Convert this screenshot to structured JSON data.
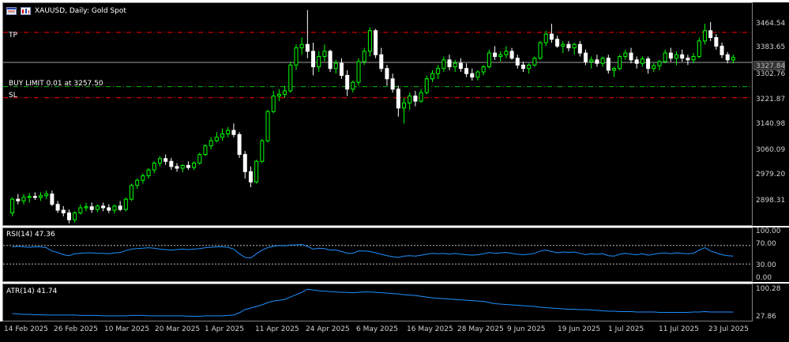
{
  "header": {
    "symbol_text": "XAUUSD, Daily:  Gold Spot",
    "icons": [
      "window-menu-icon",
      "chart-type-icon"
    ]
  },
  "levels": {
    "tp_label": "TP",
    "buy_limit_label": "BUY LIMIT 0.01 at 3257.50",
    "sl_label": "SL",
    "current_price": "3327.84"
  },
  "price_scale": [
    "3464.54",
    "3383.65",
    "3302.76",
    "3221.87",
    "3140.98",
    "3060.09",
    "2979.20",
    "2898.31"
  ],
  "rsi": {
    "label": "RSI(14) 47.36",
    "scale": [
      "100.00",
      "70.00",
      "30.00",
      "0.00"
    ]
  },
  "atr": {
    "label": "ATR(14) 41.74",
    "scale": [
      "100.28",
      "27.86"
    ]
  },
  "time_axis": [
    "14 Feb 2025",
    "26 Feb 2025",
    "10 Mar 2025",
    "20 Mar 2025",
    "1 Apr 2025",
    "11 Apr 2025",
    "24 Apr 2025",
    "6 May 2025",
    "16 May 2025",
    "28 May 2025",
    "9 Jun 2025",
    "19 Jun 2025",
    "1 Jul 2025",
    "11 Jul 2025",
    "23 Jul 2025"
  ],
  "colors": {
    "background": "#000000",
    "bull_candle": "#00ff00",
    "bear_candle": "#ffffff",
    "tp_sl_line": "#ff0000",
    "buy_limit_line": "#00c000",
    "indicator_line": "#1e90ff",
    "price_line": "#a0a0a0"
  },
  "chart_data": {
    "type": "candlestick",
    "title": "XAUUSD, Daily:  Gold Spot",
    "ylim": [
      2850,
      3500
    ],
    "levels": {
      "tp": 3415,
      "buy_limit": 3257.5,
      "sl": 3225,
      "current": 3327.84
    },
    "candles": [
      [
        2890,
        2935,
        2880,
        2930
      ],
      [
        2930,
        2945,
        2915,
        2925
      ],
      [
        2925,
        2945,
        2915,
        2935
      ],
      [
        2935,
        2948,
        2920,
        2938
      ],
      [
        2938,
        2950,
        2928,
        2935
      ],
      [
        2935,
        2950,
        2925,
        2940
      ],
      [
        2940,
        2955,
        2930,
        2945
      ],
      [
        2945,
        2955,
        2910,
        2915
      ],
      [
        2915,
        2925,
        2890,
        2898
      ],
      [
        2898,
        2910,
        2880,
        2890
      ],
      [
        2890,
        2900,
        2860,
        2870
      ],
      [
        2870,
        2895,
        2862,
        2890
      ],
      [
        2890,
        2915,
        2885,
        2905
      ],
      [
        2905,
        2920,
        2895,
        2908
      ],
      [
        2908,
        2920,
        2890,
        2900
      ],
      [
        2900,
        2915,
        2892,
        2910
      ],
      [
        2910,
        2920,
        2895,
        2905
      ],
      [
        2905,
        2915,
        2890,
        2898
      ],
      [
        2898,
        2915,
        2888,
        2910
      ],
      [
        2910,
        2925,
        2895,
        2900
      ],
      [
        2900,
        2935,
        2895,
        2930
      ],
      [
        2930,
        2975,
        2925,
        2970
      ],
      [
        2970,
        2990,
        2960,
        2985
      ],
      [
        2985,
        3005,
        2975,
        2998
      ],
      [
        2998,
        3020,
        2990,
        3015
      ],
      [
        3015,
        3040,
        3005,
        3035
      ],
      [
        3035,
        3055,
        3025,
        3048
      ],
      [
        3048,
        3060,
        3030,
        3040
      ],
      [
        3040,
        3050,
        3015,
        3025
      ],
      [
        3025,
        3035,
        3010,
        3020
      ],
      [
        3020,
        3032,
        3008,
        3028
      ],
      [
        3028,
        3040,
        3015,
        3022
      ],
      [
        3022,
        3040,
        3015,
        3035
      ],
      [
        3035,
        3065,
        3030,
        3060
      ],
      [
        3060,
        3090,
        3055,
        3085
      ],
      [
        3085,
        3110,
        3075,
        3100
      ],
      [
        3100,
        3125,
        3095,
        3110
      ],
      [
        3110,
        3135,
        3100,
        3120
      ],
      [
        3120,
        3140,
        3110,
        3130
      ],
      [
        3130,
        3150,
        3110,
        3118
      ],
      [
        3118,
        3125,
        3050,
        3060
      ],
      [
        3060,
        3070,
        2990,
        3010
      ],
      [
        3010,
        3025,
        2965,
        2980
      ],
      [
        2980,
        3045,
        2975,
        3040
      ],
      [
        3040,
        3105,
        3035,
        3100
      ],
      [
        3100,
        3190,
        3095,
        3185
      ],
      [
        3185,
        3245,
        3180,
        3230
      ],
      [
        3230,
        3250,
        3215,
        3235
      ],
      [
        3235,
        3260,
        3225,
        3245
      ],
      [
        3245,
        3330,
        3240,
        3320
      ],
      [
        3320,
        3380,
        3305,
        3370
      ],
      [
        3370,
        3400,
        3350,
        3380
      ],
      [
        3380,
        3480,
        3340,
        3360
      ],
      [
        3360,
        3385,
        3290,
        3315
      ],
      [
        3315,
        3360,
        3300,
        3345
      ],
      [
        3345,
        3380,
        3330,
        3360
      ],
      [
        3360,
        3365,
        3300,
        3310
      ],
      [
        3310,
        3335,
        3295,
        3325
      ],
      [
        3325,
        3340,
        3280,
        3290
      ],
      [
        3290,
        3305,
        3230,
        3250
      ],
      [
        3250,
        3275,
        3240,
        3270
      ],
      [
        3270,
        3340,
        3260,
        3330
      ],
      [
        3330,
        3370,
        3320,
        3360
      ],
      [
        3360,
        3430,
        3345,
        3420
      ],
      [
        3420,
        3425,
        3340,
        3350
      ],
      [
        3350,
        3370,
        3300,
        3310
      ],
      [
        3310,
        3320,
        3260,
        3280
      ],
      [
        3280,
        3295,
        3240,
        3250
      ],
      [
        3250,
        3260,
        3170,
        3195
      ],
      [
        3195,
        3225,
        3150,
        3210
      ],
      [
        3210,
        3240,
        3190,
        3230
      ],
      [
        3230,
        3245,
        3200,
        3215
      ],
      [
        3215,
        3250,
        3210,
        3240
      ],
      [
        3240,
        3290,
        3235,
        3280
      ],
      [
        3280,
        3305,
        3270,
        3295
      ],
      [
        3295,
        3320,
        3280,
        3310
      ],
      [
        3310,
        3345,
        3300,
        3335
      ],
      [
        3335,
        3350,
        3305,
        3315
      ],
      [
        3315,
        3335,
        3300,
        3325
      ],
      [
        3325,
        3340,
        3300,
        3310
      ],
      [
        3310,
        3325,
        3285,
        3295
      ],
      [
        3295,
        3310,
        3275,
        3285
      ],
      [
        3285,
        3305,
        3275,
        3300
      ],
      [
        3300,
        3320,
        3290,
        3315
      ],
      [
        3315,
        3365,
        3310,
        3355
      ],
      [
        3355,
        3375,
        3335,
        3345
      ],
      [
        3345,
        3360,
        3330,
        3350
      ],
      [
        3350,
        3375,
        3340,
        3360
      ],
      [
        3360,
        3370,
        3335,
        3340
      ],
      [
        3340,
        3350,
        3310,
        3320
      ],
      [
        3320,
        3330,
        3300,
        3310
      ],
      [
        3310,
        3325,
        3295,
        3320
      ],
      [
        3320,
        3345,
        3315,
        3340
      ],
      [
        3340,
        3390,
        3335,
        3385
      ],
      [
        3385,
        3420,
        3375,
        3410
      ],
      [
        3410,
        3440,
        3385,
        3395
      ],
      [
        3395,
        3405,
        3370,
        3375
      ],
      [
        3375,
        3390,
        3355,
        3380
      ],
      [
        3380,
        3390,
        3360,
        3370
      ],
      [
        3370,
        3385,
        3350,
        3380
      ],
      [
        3380,
        3390,
        3345,
        3355
      ],
      [
        3355,
        3365,
        3320,
        3330
      ],
      [
        3330,
        3345,
        3310,
        3335
      ],
      [
        3335,
        3350,
        3315,
        3325
      ],
      [
        3325,
        3345,
        3315,
        3340
      ],
      [
        3340,
        3350,
        3295,
        3305
      ],
      [
        3305,
        3315,
        3285,
        3310
      ],
      [
        3310,
        3350,
        3305,
        3345
      ],
      [
        3345,
        3365,
        3335,
        3355
      ],
      [
        3355,
        3370,
        3325,
        3335
      ],
      [
        3335,
        3345,
        3310,
        3325
      ],
      [
        3325,
        3345,
        3315,
        3338
      ],
      [
        3338,
        3345,
        3295,
        3310
      ],
      [
        3310,
        3325,
        3300,
        3318
      ],
      [
        3318,
        3335,
        3305,
        3330
      ],
      [
        3330,
        3365,
        3325,
        3355
      ],
      [
        3355,
        3370,
        3330,
        3340
      ],
      [
        3340,
        3360,
        3320,
        3350
      ],
      [
        3350,
        3365,
        3330,
        3340
      ],
      [
        3340,
        3350,
        3320,
        3335
      ],
      [
        3335,
        3355,
        3325,
        3345
      ],
      [
        3345,
        3400,
        3340,
        3390
      ],
      [
        3390,
        3440,
        3380,
        3420
      ],
      [
        3420,
        3445,
        3390,
        3400
      ],
      [
        3400,
        3410,
        3365,
        3375
      ],
      [
        3375,
        3385,
        3340,
        3350
      ],
      [
        3350,
        3358,
        3325,
        3335
      ],
      [
        3335,
        3350,
        3325,
        3342
      ]
    ],
    "rsi_values": [
      67,
      68,
      67,
      66,
      67,
      67,
      65,
      58,
      55,
      50,
      48,
      52,
      53,
      54,
      54,
      53,
      53,
      52,
      54,
      55,
      59,
      62,
      63,
      64,
      65,
      64,
      62,
      61,
      60,
      61,
      62,
      61,
      62,
      63,
      65,
      66,
      67,
      67,
      66,
      62,
      52,
      44,
      43,
      52,
      60,
      65,
      68,
      70,
      69,
      71,
      71,
      72,
      68,
      62,
      64,
      63,
      60,
      60,
      57,
      53,
      53,
      58,
      58,
      57,
      54,
      51,
      48,
      46,
      44,
      47,
      48,
      47,
      49,
      51,
      53,
      52,
      53,
      51,
      53,
      51,
      50,
      49,
      50,
      52,
      55,
      53,
      54,
      55,
      53,
      51,
      50,
      51,
      53,
      58,
      60,
      57,
      54,
      56,
      55,
      56,
      53,
      50,
      52,
      51,
      52,
      48,
      47,
      51,
      53,
      51,
      50,
      52,
      49,
      51,
      53,
      54,
      52,
      54,
      53,
      52,
      53,
      60,
      65,
      58,
      54,
      50,
      48,
      47
    ],
    "atr_values": [
      38,
      37,
      36,
      36,
      35,
      35,
      34,
      34,
      34,
      34,
      34,
      34,
      33,
      33,
      33,
      33,
      32,
      32,
      32,
      32,
      32,
      33,
      33,
      33,
      32,
      32,
      32,
      32,
      32,
      32,
      32,
      31,
      31,
      31,
      32,
      32,
      32,
      32,
      33,
      34,
      40,
      48,
      52,
      56,
      60,
      66,
      70,
      72,
      74,
      80,
      86,
      92,
      100,
      98,
      96,
      95,
      94,
      93,
      92,
      92,
      91,
      92,
      93,
      93,
      92,
      91,
      90,
      89,
      88,
      86,
      85,
      84,
      82,
      80,
      78,
      77,
      76,
      75,
      74,
      73,
      72,
      71,
      70,
      69,
      66,
      63,
      62,
      61,
      60,
      59,
      58,
      57,
      56,
      54,
      53,
      52,
      51,
      50,
      49,
      49,
      48,
      48,
      47,
      46,
      45,
      44,
      44,
      43,
      43,
      43,
      42,
      42,
      42,
      42,
      41,
      41,
      41,
      41,
      41,
      41,
      42,
      42,
      43,
      42,
      42,
      42,
      42,
      41.74
    ]
  }
}
